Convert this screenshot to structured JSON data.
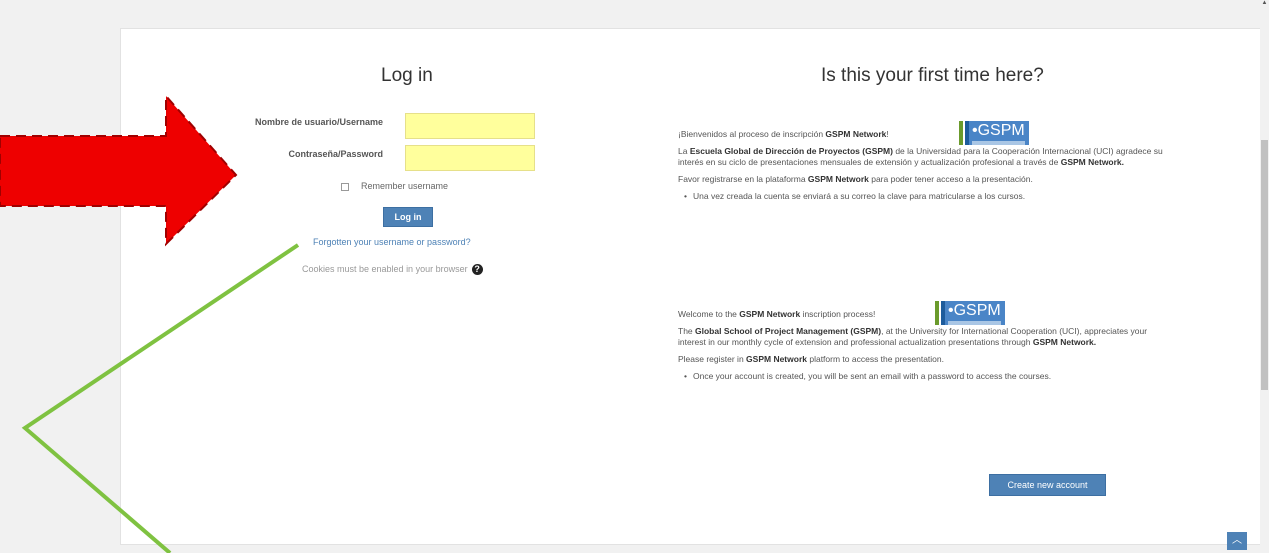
{
  "login": {
    "title": "Log in",
    "username_label": "Nombre de usuario/Username",
    "username_value": "",
    "password_label": "Contraseña/Password",
    "password_value": "",
    "remember_label": "Remember username",
    "login_button": "Log in",
    "forgot_link": "Forgotten your username or password?",
    "cookies_notice": "Cookies must be enabled in your browser"
  },
  "signup": {
    "title": "Is this your first time here?",
    "logo_text": "GSPM",
    "es": {
      "welcome_prefix": "¡Bienvenidos al proceso de inscripción ",
      "welcome_bold": "GSPM Network",
      "welcome_suffix": "!",
      "p1_prefix": "La ",
      "p1_bold1": "Escuela Global de Dirección de Proyectos (GSPM)",
      "p1_mid": " de la Universidad para la Cooperación Internacional (UCI) agradece su interés en su ciclo de presentaciones mensuales de extensión y actualización profesional a través de ",
      "p1_bold2": "GSPM Network.",
      "p2_prefix": "Favor registrarse en la plataforma ",
      "p2_bold": "GSPM Network",
      "p2_suffix": " para poder tener acceso a la presentación.",
      "bullet": "Una vez creada la cuenta se enviará a su correo la clave para matricularse a los cursos."
    },
    "en": {
      "welcome_prefix": "Welcome to the ",
      "welcome_bold": "GSPM Network",
      "welcome_suffix": " inscription process!",
      "p1_prefix": "The ",
      "p1_bold1": "Global School of Project Management (GSPM)",
      "p1_mid": ", at the University for International Cooperation (UCI), appreciates your interest in our monthly cycle of extension and professional actualization presentations through ",
      "p1_bold2": "GSPM Network.",
      "p2_prefix": "Please register in ",
      "p2_bold": "GSPM Network",
      "p2_suffix": " platform to access the presentation.",
      "bullet": "Once your account is created, you will be sent an email with a password to access the courses."
    },
    "create_button": "Create new account"
  },
  "colors": {
    "arrow": "#ee0000",
    "annotation_line": "#7fc241",
    "button": "#4e82b6",
    "input_fill": "#ffff9c"
  },
  "icons": {
    "help": "question-circle-icon",
    "back_to_top": "chevron-up-icon",
    "scroll_up": "triangle-up-icon"
  }
}
